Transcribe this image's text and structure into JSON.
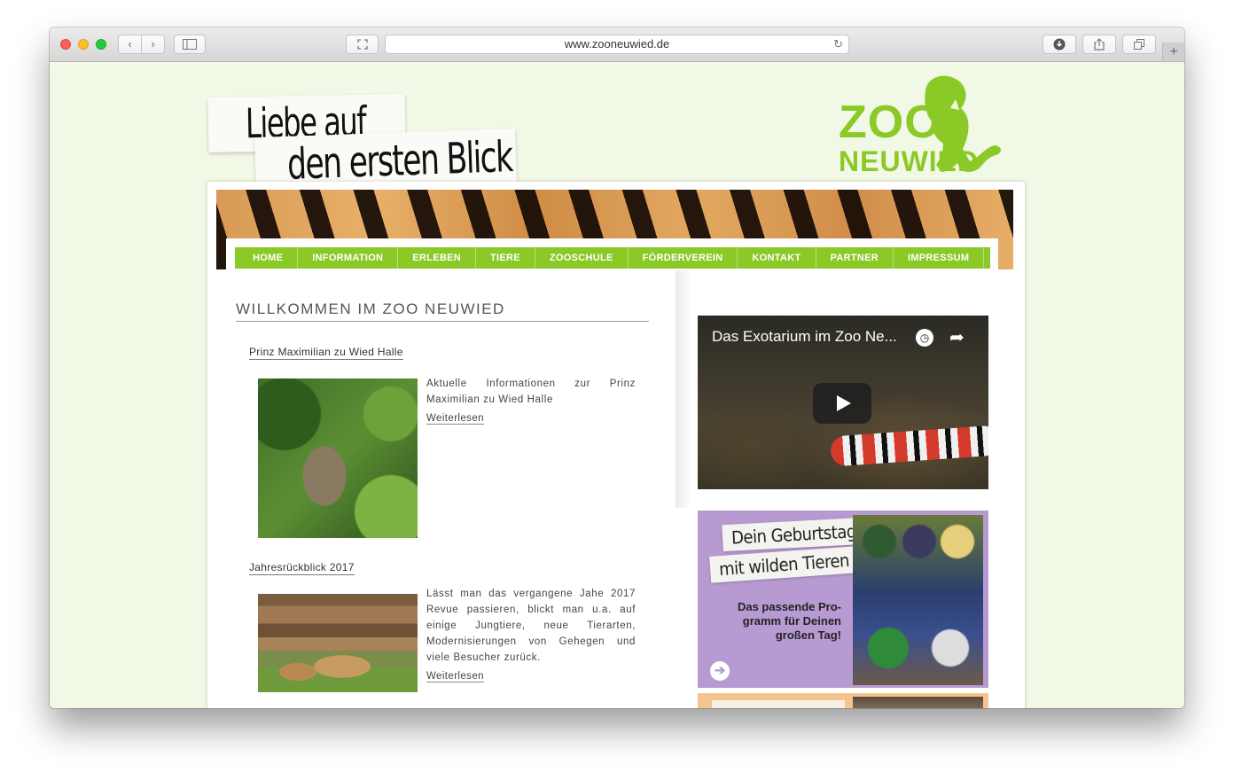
{
  "browser": {
    "url": "www.zooneuwied.de",
    "back_glyph": "‹",
    "forward_glyph": "›",
    "new_tab_glyph": "+",
    "icons": [
      "sidebar-icon",
      "fullscreen-icon",
      "reload-icon",
      "download-icon",
      "share-icon",
      "tabs-icon"
    ]
  },
  "header": {
    "slogan_line1": "Liebe auf",
    "slogan_line2": "den ersten Blick",
    "logo_top": "ZOO",
    "logo_bottom": "NEUWIED",
    "brand_color": "#8ac926"
  },
  "nav": {
    "items": [
      "HOME",
      "INFORMATION",
      "ERLEBEN",
      "TIERE",
      "ZOOSCHULE",
      "FÖRDERVEREIN",
      "KONTAKT",
      "PARTNER",
      "IMPRESSUM"
    ]
  },
  "main": {
    "title": "WILLKOMMEN IM ZOO NEUWIED",
    "articles": [
      {
        "title": "Prinz Maximilian zu Wied Halle",
        "text": "Aktuelle Informationen zur Prinz Maximilian zu Wied Halle",
        "link": "Weiterlesen"
      },
      {
        "title": "Jahresrückblick 2017",
        "text": "Lässt man das vergangene Jahe 2017 Revue passieren, blickt man u.a. auf einige Jungtiere, neue Tierarten, Modernisierungen von Gehegen und viele Besucher zurück.",
        "link": "Weiterlesen"
      }
    ]
  },
  "sidebar": {
    "video_title": "Das Exotarium im Zoo Ne...",
    "birthday_line1": "Dein Geburtstag",
    "birthday_line2": "mit wilden Tieren",
    "birthday_text": "Das passende Pro-gramm für Deinen großen Tag!",
    "birthday_bg": "#b79ad1"
  }
}
